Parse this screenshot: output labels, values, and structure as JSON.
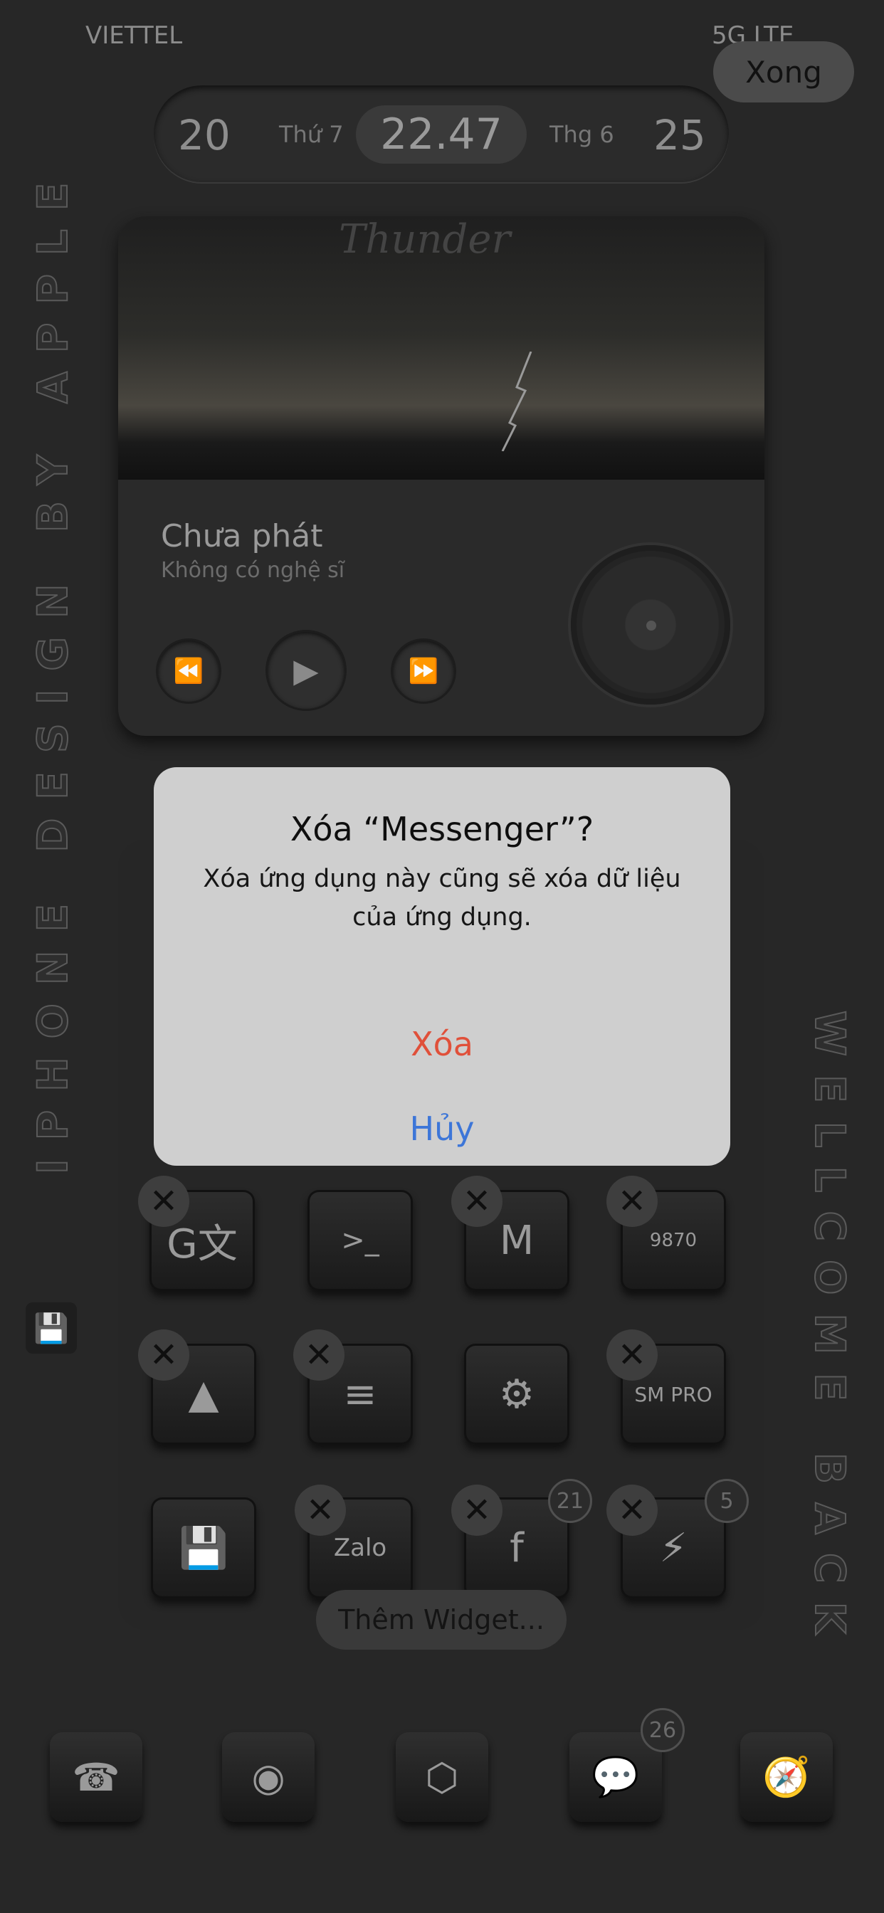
{
  "status_bar": {
    "carrier": "VIETTEL",
    "network": "5G LTE",
    "done_label": "Xong"
  },
  "date_widget": {
    "day_left": "20",
    "weekday": "Thứ 7",
    "time": "22.47",
    "month": "Thg 6",
    "day_right": "25"
  },
  "side_text": {
    "left": "IPHONE DESIGN BY APPLE",
    "right": "WELLCOME BACK"
  },
  "music_widget": {
    "logo": "Thunder",
    "title": "Chưa phát",
    "artist": "Không có nghệ sĩ"
  },
  "grid": {
    "row1": [
      {
        "label": "G文",
        "icon": "google-translate-icon"
      },
      {
        "label": ">_",
        "icon": "terminal-icon"
      },
      {
        "label": "M",
        "icon": "gmail-icon"
      },
      {
        "label": "9870",
        "icon": "calculator-icon"
      }
    ],
    "row2": [
      {
        "label": "▲",
        "icon": "google-drive-icon"
      },
      {
        "label": "≡",
        "icon": "notes-icon"
      },
      {
        "label": "⚙",
        "icon": "settings-gear-icon"
      },
      {
        "label": "SM PRO",
        "icon": "sm-pro-icon"
      }
    ],
    "row3": [
      {
        "label": "💾",
        "icon": "floppy-disk-icon"
      },
      {
        "label": "Zalo",
        "icon": "zalo-icon"
      },
      {
        "label": "f",
        "icon": "facebook-icon",
        "badge": "21"
      },
      {
        "label": "⚡",
        "icon": "messenger-icon",
        "badge": "5"
      }
    ]
  },
  "add_widget_label": "Thêm Widget...",
  "dock": [
    {
      "label": "☎",
      "icon": "phone-icon"
    },
    {
      "label": "◉",
      "icon": "camera-icon"
    },
    {
      "label": "⬡",
      "icon": "package-icon"
    },
    {
      "label": "💬",
      "icon": "messages-icon",
      "badge": "26"
    },
    {
      "label": "🧭",
      "icon": "compass-icon"
    }
  ],
  "alert": {
    "title": "Xóa “Messenger”?",
    "message": "Xóa ứng dụng này cũng sẽ xóa dữ liệu của ứng dụng.",
    "delete_label": "Xóa",
    "cancel_label": "Hủy"
  },
  "colors": {
    "destructive": "#e0503a",
    "accent": "#3d76d8",
    "dialog_bg": "#cfcfcf"
  }
}
